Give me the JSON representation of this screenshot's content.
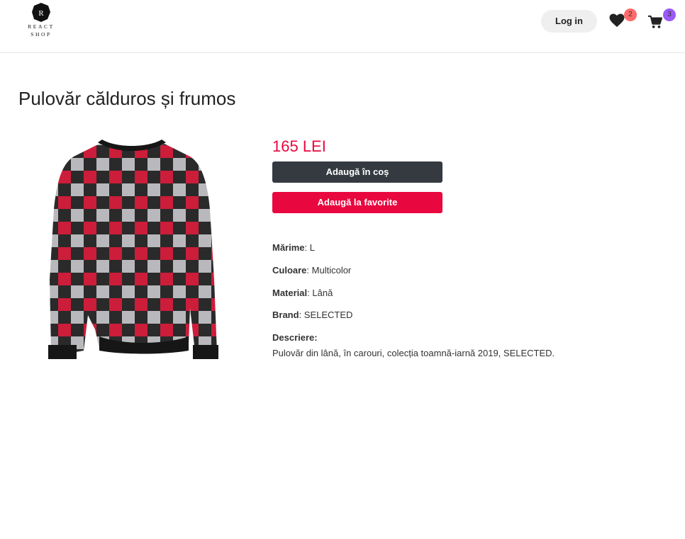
{
  "header": {
    "logo_letter": "R",
    "logo_line1": "REACT",
    "logo_line2": "SHOP",
    "login_label": "Log in",
    "favorites_count": "2",
    "cart_count": "3",
    "favorites_icon": "heart-icon",
    "cart_icon": "cart-icon"
  },
  "product": {
    "title": "Pulovăr călduros și frumos",
    "price": "165 LEI",
    "add_to_cart_label": "Adaugă în coș",
    "add_to_favorites_label": "Adaugă la favorite",
    "specs": [
      {
        "label": "Mărime",
        "sep": ": ",
        "value": "L"
      },
      {
        "label": "Culoare",
        "sep": ": ",
        "value": "Multicolor"
      },
      {
        "label": "Material",
        "sep": ": ",
        "value": "Lână"
      },
      {
        "label": "Brand",
        "sep": ": ",
        "value": "SELECTED"
      }
    ],
    "description_label": "Descriere:",
    "description": "Pulovăr din lână, în carouri, colecția toamnă-iarnă 2019, SELECTED."
  },
  "colors": {
    "accent": "#e8073f",
    "dark_button": "#343a40",
    "fav_badge": "#ff6b6b",
    "cart_badge": "#9b59f5"
  }
}
